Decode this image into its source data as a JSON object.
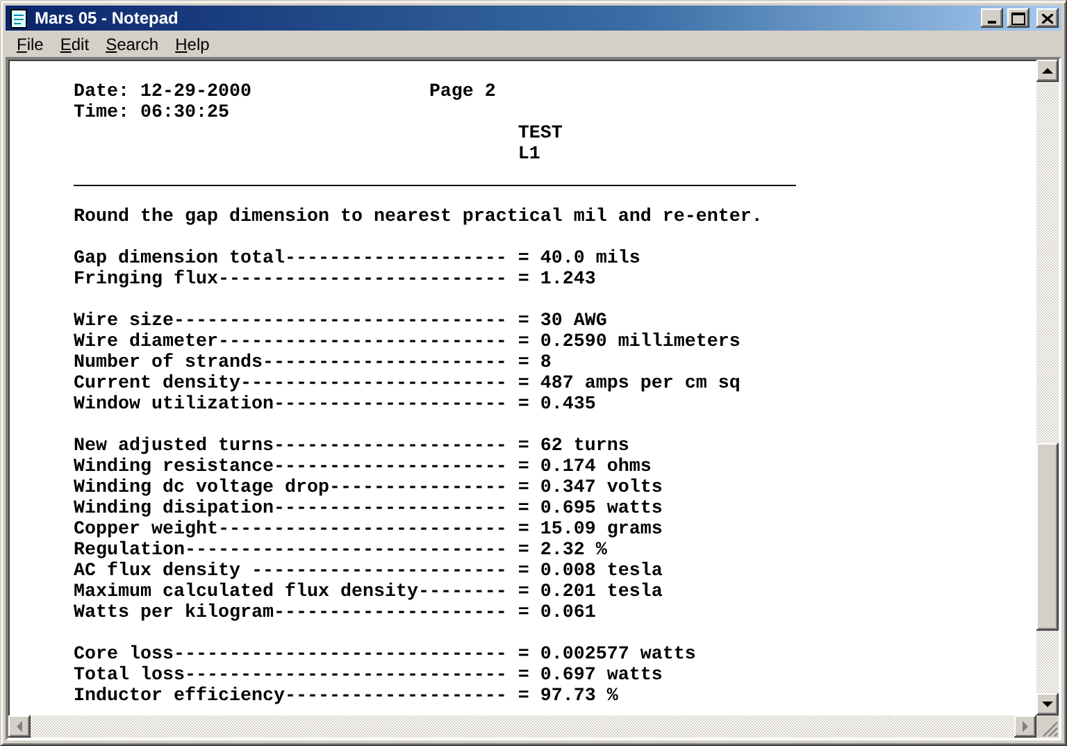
{
  "window": {
    "title": "Mars 05 - Notepad"
  },
  "menu": [
    "File",
    "Edit",
    "Search",
    "Help"
  ],
  "document": {
    "header": {
      "date": "Date: 12-29-2000",
      "page": "Page 2",
      "time": "Time: 06:30:25",
      "titles": [
        "TEST",
        "L1"
      ]
    },
    "note": "Round the gap dimension to nearest practical mil and re-enter.",
    "groups": [
      [
        "Gap dimension total-------------------- = 40.0 mils",
        "Fringing flux-------------------------- = 1.243"
      ],
      [
        "Wire size------------------------------ = 30 AWG",
        "Wire diameter-------------------------- = 0.2590 millimeters",
        "Number of strands---------------------- = 8",
        "Current density------------------------ = 487 amps per cm sq",
        "Window utilization--------------------- = 0.435"
      ],
      [
        "New adjusted turns--------------------- = 62 turns",
        "Winding resistance--------------------- = 0.174 ohms",
        "Winding dc voltage drop---------------- = 0.347 volts",
        "Winding disipation--------------------- = 0.695 watts",
        "Copper weight-------------------------- = 15.09 grams",
        "Regulation----------------------------- = 2.32 %",
        "AC flux density ----------------------- = 0.008 tesla",
        "Maximum calculated flux density-------- = 0.201 tesla",
        "Watts per kilogram--------------------- = 0.061"
      ],
      [
        "Core loss------------------------------ = 0.002577 watts",
        "Total loss----------------------------- = 0.697 watts",
        "Inductor efficiency-------------------- = 97.73 %"
      ]
    ]
  }
}
